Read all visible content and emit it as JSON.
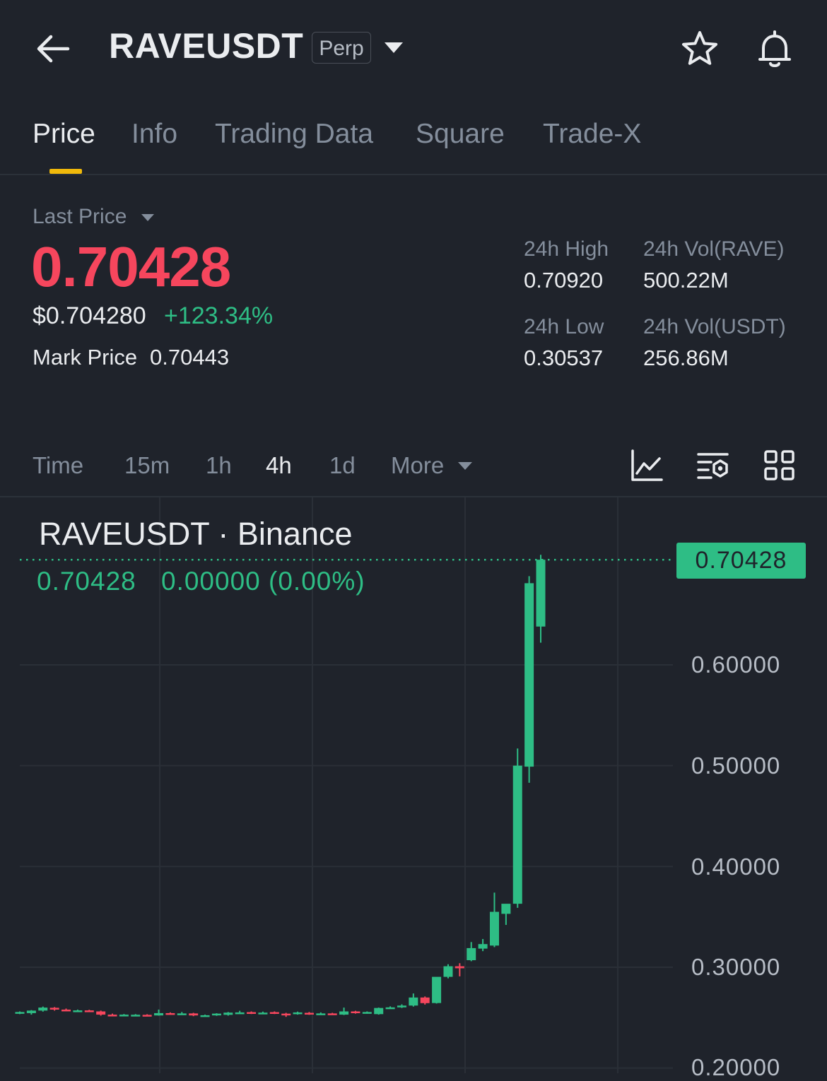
{
  "header": {
    "symbol": "RAVEUSDT",
    "contract_badge": "Perp",
    "icons": [
      "back-arrow-icon",
      "dropdown-caret-icon",
      "star-icon",
      "bell-icon"
    ]
  },
  "tabs": [
    {
      "label": "Price",
      "active": true
    },
    {
      "label": "Info"
    },
    {
      "label": "Trading Data"
    },
    {
      "label": "Square"
    },
    {
      "label": "Trade-X"
    }
  ],
  "ticker": {
    "last_price_label": "Last Price",
    "last_price": "0.70428",
    "usd_price": "$0.704280",
    "change_pct": "+123.34%",
    "mark_price_label": "Mark Price",
    "mark_price": "0.70443",
    "high_label": "24h High",
    "high": "0.70920",
    "low_label": "24h Low",
    "low": "0.30537",
    "vol_base_label": "24h Vol(RAVE)",
    "vol_base": "500.22M",
    "vol_quote_label": "24h Vol(USDT)",
    "vol_quote": "256.86M"
  },
  "intervals": [
    {
      "label": "Time"
    },
    {
      "label": "15m"
    },
    {
      "label": "1h"
    },
    {
      "label": "4h",
      "active": true
    },
    {
      "label": "1d"
    },
    {
      "label": "More"
    }
  ],
  "toolbar_icons": [
    "line-chart-icon",
    "indicator-settings-icon",
    "grid-layout-icon"
  ],
  "colors": {
    "up": "#2ebd85",
    "down": "#f6465d",
    "accent": "#f0b90b",
    "background": "#1f232b"
  },
  "chart_header": {
    "title": "RAVEUSDT · Binance",
    "price": "0.70428",
    "change": "0.00000 (0.00%)",
    "current_price_tag": "0.70428"
  },
  "chart_data": {
    "type": "candlestick",
    "interval": "4h",
    "y_ticks": [
      "0.60000",
      "0.50000",
      "0.40000",
      "0.30000",
      "0.20000"
    ],
    "ylim": [
      0.19,
      0.74
    ],
    "current_price": 0.70428,
    "candles": [
      {
        "o": 0.2548,
        "h": 0.2562,
        "l": 0.2535,
        "c": 0.2556
      },
      {
        "o": 0.2545,
        "h": 0.2575,
        "l": 0.253,
        "c": 0.257
      },
      {
        "o": 0.257,
        "h": 0.261,
        "l": 0.256,
        "c": 0.26
      },
      {
        "o": 0.2598,
        "h": 0.2605,
        "l": 0.257,
        "c": 0.258
      },
      {
        "o": 0.258,
        "h": 0.259,
        "l": 0.2565,
        "c": 0.257
      },
      {
        "o": 0.2568,
        "h": 0.258,
        "l": 0.2555,
        "c": 0.2572
      },
      {
        "o": 0.2572,
        "h": 0.2578,
        "l": 0.2558,
        "c": 0.2562
      },
      {
        "o": 0.2562,
        "h": 0.257,
        "l": 0.252,
        "c": 0.253
      },
      {
        "o": 0.253,
        "h": 0.254,
        "l": 0.252,
        "c": 0.2528
      },
      {
        "o": 0.2528,
        "h": 0.2536,
        "l": 0.252,
        "c": 0.253
      },
      {
        "o": 0.2525,
        "h": 0.2535,
        "l": 0.2518,
        "c": 0.2529
      },
      {
        "o": 0.2528,
        "h": 0.2534,
        "l": 0.2518,
        "c": 0.2524
      },
      {
        "o": 0.2522,
        "h": 0.258,
        "l": 0.252,
        "c": 0.2545
      },
      {
        "o": 0.2545,
        "h": 0.2552,
        "l": 0.253,
        "c": 0.2538
      },
      {
        "o": 0.2535,
        "h": 0.2556,
        "l": 0.2528,
        "c": 0.2542
      },
      {
        "o": 0.2542,
        "h": 0.2548,
        "l": 0.2515,
        "c": 0.2522
      },
      {
        "o": 0.252,
        "h": 0.253,
        "l": 0.2512,
        "c": 0.2524
      },
      {
        "o": 0.2524,
        "h": 0.2544,
        "l": 0.2518,
        "c": 0.254
      },
      {
        "o": 0.2528,
        "h": 0.2556,
        "l": 0.252,
        "c": 0.255
      },
      {
        "o": 0.255,
        "h": 0.2568,
        "l": 0.254,
        "c": 0.2552
      },
      {
        "o": 0.2555,
        "h": 0.2562,
        "l": 0.2536,
        "c": 0.2546
      },
      {
        "o": 0.2546,
        "h": 0.256,
        "l": 0.2536,
        "c": 0.255
      },
      {
        "o": 0.2555,
        "h": 0.2562,
        "l": 0.2536,
        "c": 0.2544
      },
      {
        "o": 0.254,
        "h": 0.2548,
        "l": 0.2508,
        "c": 0.2534
      },
      {
        "o": 0.2538,
        "h": 0.256,
        "l": 0.253,
        "c": 0.2552
      },
      {
        "o": 0.2548,
        "h": 0.2556,
        "l": 0.2528,
        "c": 0.2536
      },
      {
        "o": 0.254,
        "h": 0.2552,
        "l": 0.2528,
        "c": 0.2542
      },
      {
        "o": 0.2542,
        "h": 0.2548,
        "l": 0.2536,
        "c": 0.2541
      },
      {
        "o": 0.253,
        "h": 0.26,
        "l": 0.2526,
        "c": 0.2562
      },
      {
        "o": 0.2562,
        "h": 0.2568,
        "l": 0.254,
        "c": 0.2546
      },
      {
        "o": 0.2546,
        "h": 0.2562,
        "l": 0.254,
        "c": 0.2556
      },
      {
        "o": 0.2535,
        "h": 0.26,
        "l": 0.253,
        "c": 0.2596
      },
      {
        "o": 0.2596,
        "h": 0.2612,
        "l": 0.259,
        "c": 0.2602
      },
      {
        "o": 0.2602,
        "h": 0.2632,
        "l": 0.2596,
        "c": 0.262
      },
      {
        "o": 0.262,
        "h": 0.274,
        "l": 0.261,
        "c": 0.27
      },
      {
        "o": 0.27,
        "h": 0.271,
        "l": 0.263,
        "c": 0.2644
      },
      {
        "o": 0.2645,
        "h": 0.286,
        "l": 0.264,
        "c": 0.2905
      },
      {
        "o": 0.2905,
        "h": 0.303,
        "l": 0.289,
        "c": 0.301
      },
      {
        "o": 0.301,
        "h": 0.304,
        "l": 0.291,
        "c": 0.299
      },
      {
        "o": 0.307,
        "h": 0.325,
        "l": 0.306,
        "c": 0.319
      },
      {
        "o": 0.3185,
        "h": 0.328,
        "l": 0.316,
        "c": 0.323
      },
      {
        "o": 0.3215,
        "h": 0.374,
        "l": 0.32,
        "c": 0.355
      },
      {
        "o": 0.353,
        "h": 0.356,
        "l": 0.342,
        "c": 0.363
      },
      {
        "o": 0.363,
        "h": 0.517,
        "l": 0.359,
        "c": 0.5
      },
      {
        "o": 0.499,
        "h": 0.688,
        "l": 0.483,
        "c": 0.681
      },
      {
        "o": 0.638,
        "h": 0.7092,
        "l": 0.622,
        "c": 0.7043
      }
    ]
  }
}
